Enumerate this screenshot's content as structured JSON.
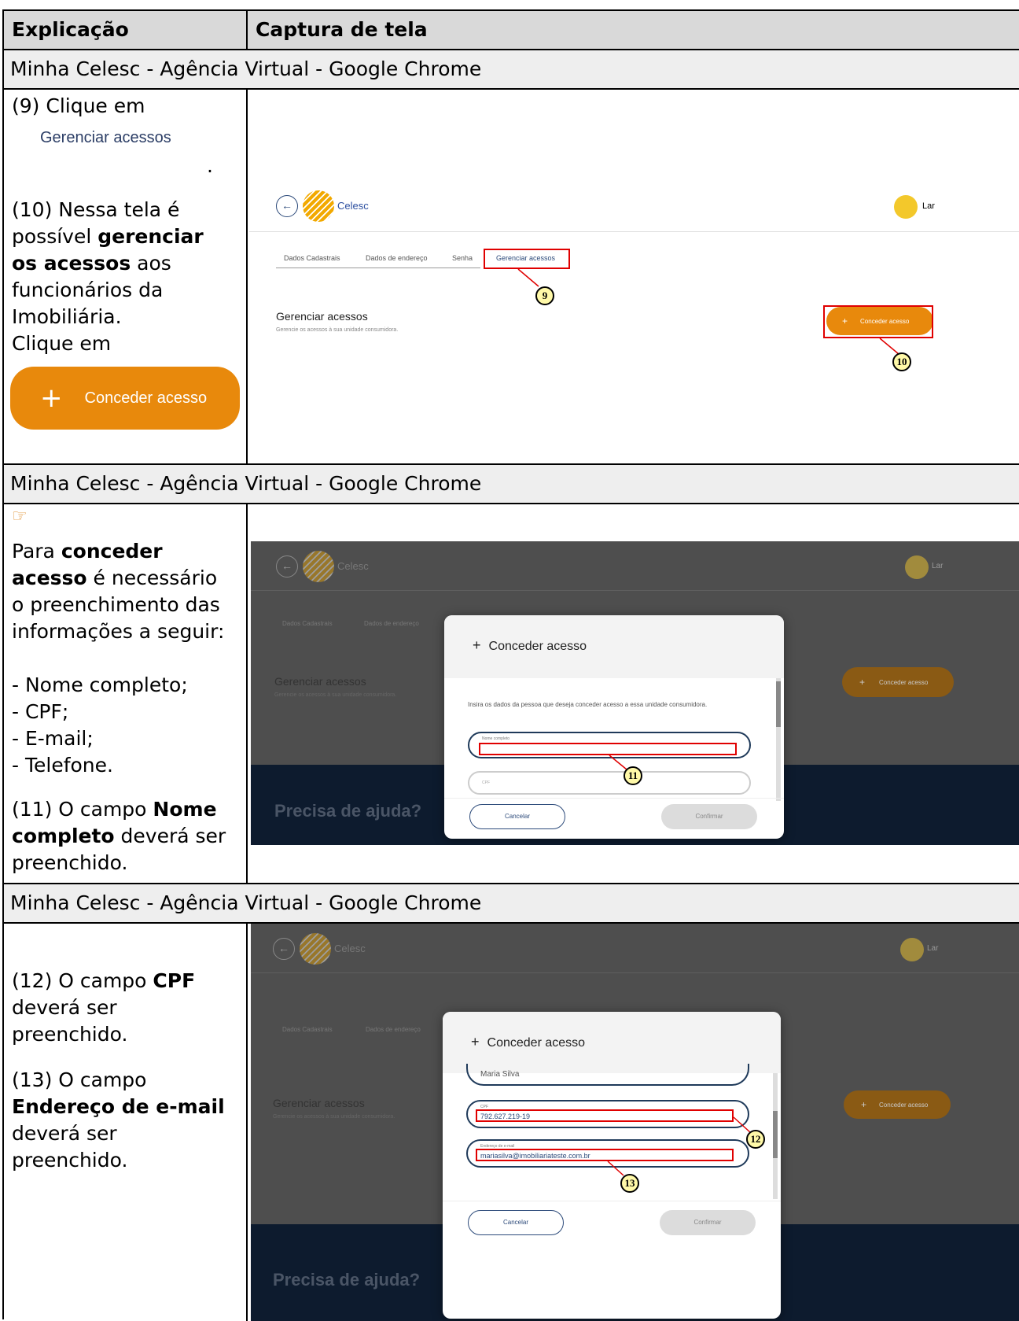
{
  "headers": {
    "col1": "Explicação",
    "col2": "Captura de tela"
  },
  "window_title": "Minha Celesc - Agência Virtual - Google Chrome",
  "row1": {
    "step9": "(9) Clique em",
    "link_text": "Gerenciar acessos",
    "dot": ".",
    "step10_a": "(10) Nessa tela é",
    "step10_b": "possível ",
    "step10_b_bold": "gerenciar",
    "step10_c_bold": "os acessos",
    "step10_c": " aos",
    "step10_d": "funcionários da",
    "step10_e": "Imobiliária.",
    "step10_f": "Clique em",
    "button_label": "Conceder acesso",
    "shot": {
      "logo": "Celesc",
      "user": "Lar",
      "tabs": [
        "Dados Cadastrais",
        "Dados de endereço",
        "Senha",
        "Gerenciar acessos"
      ],
      "heading": "Gerenciar acessos",
      "sub": "Gerencie os acessos à sua unidade consumidora.",
      "button": "Conceder acesso",
      "callout_a": "9",
      "callout_b": "10"
    }
  },
  "row2": {
    "p1": "Para ",
    "p1_bold": "conceder",
    "p2_bold": "acesso",
    "p2": " é necessário",
    "p3": "o preenchimento das",
    "p4": "informações a seguir:",
    "list": [
      "- Nome completo;",
      "- CPF;",
      "- E-mail;",
      "- Telefone."
    ],
    "s11_a": "(11) O campo ",
    "s11_a_bold": "Nome",
    "s11_b_bold": "completo",
    "s11_b": "  deverá ser",
    "s11_c": "preenchido.",
    "shot": {
      "logo": "Celesc",
      "user": "Lar",
      "tabs": [
        "Dados Cadastrais",
        "Dados de endereço"
      ],
      "heading": "Gerenciar acessos",
      "sub": "Gerencie os acessos à sua unidade consumidora.",
      "bg_button": "Conceder acesso",
      "help": "Precisa de ajuda?",
      "modal_title": "Conceder acesso",
      "modal_text": "Insira os dados da pessoa que deseja conceder acesso a essa unidade consumidora.",
      "field1_label": "Nome completo",
      "field2_label": "CPF",
      "cancel": "Cancelar",
      "confirm": "Confirmar",
      "callout": "11"
    }
  },
  "row3": {
    "s12_a": "(12) O campo ",
    "s12_a_bold": "CPF",
    "s12_b": " deverá ser",
    "s12_c": "preenchido.",
    "s13_a": "(13) O campo",
    "s13_b_bold": "Endereço de e-mail",
    "s13_c": "deverá ser",
    "s13_d": "preenchido.",
    "shot": {
      "logo": "Celesc",
      "user": "Lar",
      "tabs": [
        "Dados Cadastrais",
        "Dados de endereço"
      ],
      "heading": "Gerenciar acessos",
      "sub": "Gerencie os acessos à sua unidade consumidora.",
      "bg_button": "Conceder acesso",
      "help": "Precisa de ajuda?",
      "modal_title": "Conceder acesso",
      "name_value": "Maria Silva",
      "cpf_label": "CPF",
      "cpf_value": "792.627.219-19",
      "email_label": "Endereço de e-mail",
      "email_value": "mariasilva@imobiliariateste.com.br",
      "cancel": "Cancelar",
      "confirm": "Confirmar",
      "callout_a": "12",
      "callout_b": "13"
    }
  },
  "colors": {
    "orange": "#e8890c",
    "red": "#e00000",
    "callout": "#fff9a8",
    "dark": "#0d1b2e"
  },
  "icons": [
    "pointing-hand-icon",
    "plus-icon",
    "back-arrow-icon",
    "user-avatar-icon",
    "celesc-logo-icon"
  ]
}
